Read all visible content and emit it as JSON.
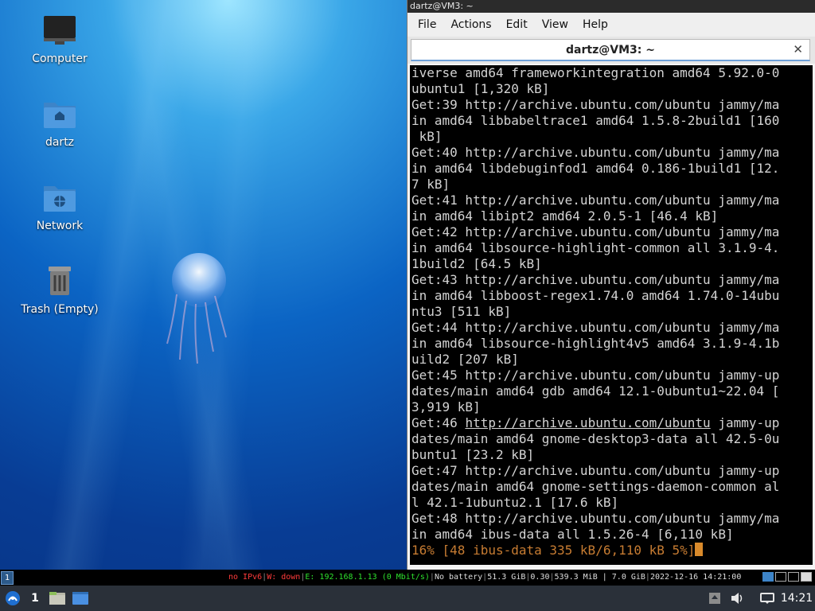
{
  "desktop": {
    "icons": [
      {
        "label": "Computer"
      },
      {
        "label": "dartz"
      },
      {
        "label": "Network"
      },
      {
        "label": "Trash (Empty)"
      }
    ]
  },
  "terminal": {
    "window_title": "dartz@VM3: ~",
    "menu": [
      "File",
      "Actions",
      "Edit",
      "View",
      "Help"
    ],
    "tab_title": "dartz@VM3: ~",
    "lines": [
      "iverse amd64 frameworkintegration amd64 5.92.0-0",
      "ubuntu1 [1,320 kB]",
      "Get:39 http://archive.ubuntu.com/ubuntu jammy/ma",
      "in amd64 libbabeltrace1 amd64 1.5.8-2build1 [160",
      " kB]",
      "Get:40 http://archive.ubuntu.com/ubuntu jammy/ma",
      "in amd64 libdebuginfod1 amd64 0.186-1build1 [12.",
      "7 kB]",
      "Get:41 http://archive.ubuntu.com/ubuntu jammy/ma",
      "in amd64 libipt2 amd64 2.0.5-1 [46.4 kB]",
      "Get:42 http://archive.ubuntu.com/ubuntu jammy/ma",
      "in amd64 libsource-highlight-common all 3.1.9-4.",
      "1build2 [64.5 kB]",
      "Get:43 http://archive.ubuntu.com/ubuntu jammy/ma",
      "in amd64 libboost-regex1.74.0 amd64 1.74.0-14ubu",
      "ntu3 [511 kB]",
      "Get:44 http://archive.ubuntu.com/ubuntu jammy/ma",
      "in amd64 libsource-highlight4v5 amd64 3.1.9-4.1b",
      "uild2 [207 kB]",
      "Get:45 http://archive.ubuntu.com/ubuntu jammy-up",
      "dates/main amd64 gdb amd64 12.1-0ubuntu1~22.04 [",
      "3,919 kB]"
    ],
    "hover_line": {
      "prefix": "Get:46 ",
      "link": "http://archive.ubuntu.com/ubuntu",
      "suffix": " jammy-up"
    },
    "lines_after": [
      "dates/main amd64 gnome-desktop3-data all 42.5-0u",
      "buntu1 [23.2 kB]",
      "Get:47 http://archive.ubuntu.com/ubuntu jammy-up",
      "dates/main amd64 gnome-settings-daemon-common al",
      "l 42.1-1ubuntu2.1 [17.6 kB]",
      "Get:48 http://archive.ubuntu.com/ubuntu jammy/ma",
      "in amd64 ibus-data all 1.5.26-4 [6,110 kB]"
    ],
    "progress_line": "16% [48 ibus-data 335 kB/6,110 kB 5%]"
  },
  "statusbar": {
    "workspace": "1",
    "ipv6": "no IPv6",
    "wifi": "W: down",
    "ethernet": "E: 192.168.1.13 (0 Mbit/s)",
    "battery": "No battery",
    "disk": "51.3 GiB",
    "load": "0.30",
    "memory": "539.3 MiB | 7.0 GiB",
    "datetime": "2022-12-16 14:21:00"
  },
  "taskbar": {
    "workspace": "1",
    "clock": "14:21"
  },
  "colors": {
    "terminal_bg": "#000000",
    "terminal_fg": "#d3d3d3",
    "progress": "#c77c32",
    "status_red": "#ff3b3b",
    "status_green": "#2ee02e",
    "taskbar_bg": "#2a3039"
  }
}
